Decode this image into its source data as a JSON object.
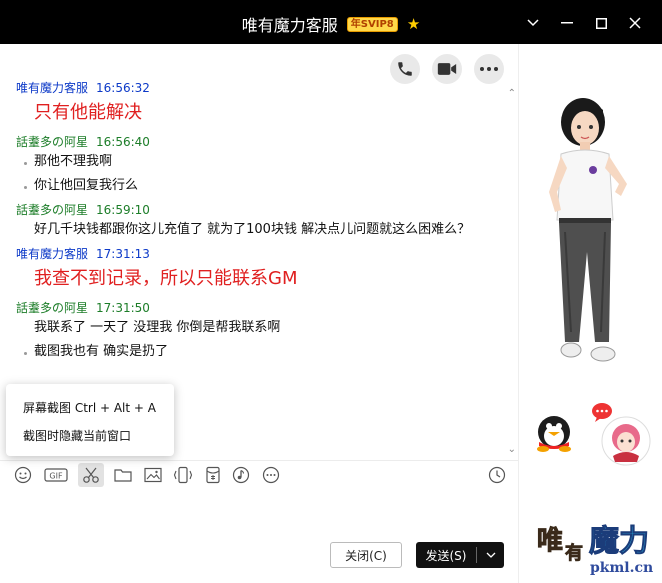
{
  "window": {
    "title": "唯有魔力客服",
    "vip_badge": "年SVIP8"
  },
  "colors": {
    "titlebar_bg": "#000000",
    "staff_name": "#0d3ac8",
    "user_name": "#1c7d28",
    "highlight_text": "#e02020",
    "send_button": "#111111"
  },
  "chat": {
    "messages": [
      {
        "sender": "唯有魔力客服",
        "time": "16:56:32",
        "role": "staff"
      },
      {
        "text": "只有他能解决",
        "style": "big"
      },
      {
        "sender": "話耋多の阿星",
        "time": "16:56:40",
        "role": "user"
      },
      {
        "text": "那他不理我啊",
        "style": "dot"
      },
      {
        "text": "你让他回复我行么",
        "style": "dot"
      },
      {
        "sender": "話耋多の阿星",
        "time": "16:59:10",
        "role": "user"
      },
      {
        "text": "好几千块钱都跟你这儿充值了 就为了100块钱 解决点儿问题就这么困难么？",
        "style": "plain"
      },
      {
        "sender": "唯有魔力客服",
        "time": "17:31:13",
        "role": "staff"
      },
      {
        "text": "我查不到记录，所以只能联系GM",
        "style": "big"
      },
      {
        "sender": "話耋多の阿星",
        "time": "17:31:50",
        "role": "user"
      },
      {
        "text": "我联系了 一天了 没理我 你倒是帮我联系啊",
        "style": "plain"
      },
      {
        "text": "截图我也有 确实是扔了",
        "style": "dot"
      }
    ]
  },
  "popup": {
    "items": [
      "屏幕截图 Ctrl + Alt + A",
      "截图时隐藏当前窗口"
    ]
  },
  "toolbar": {
    "icons": [
      "emoji-icon",
      "gif-icon",
      "scissors-icon",
      "folder-icon",
      "image-icon",
      "shake-icon",
      "red-packet-icon",
      "music-icon",
      "more-icon",
      "history-clock-icon"
    ]
  },
  "buttons": {
    "close_label": "关闭(C)",
    "send_label": "发送(S)"
  },
  "watermark": {
    "url": "pkml.cn"
  }
}
